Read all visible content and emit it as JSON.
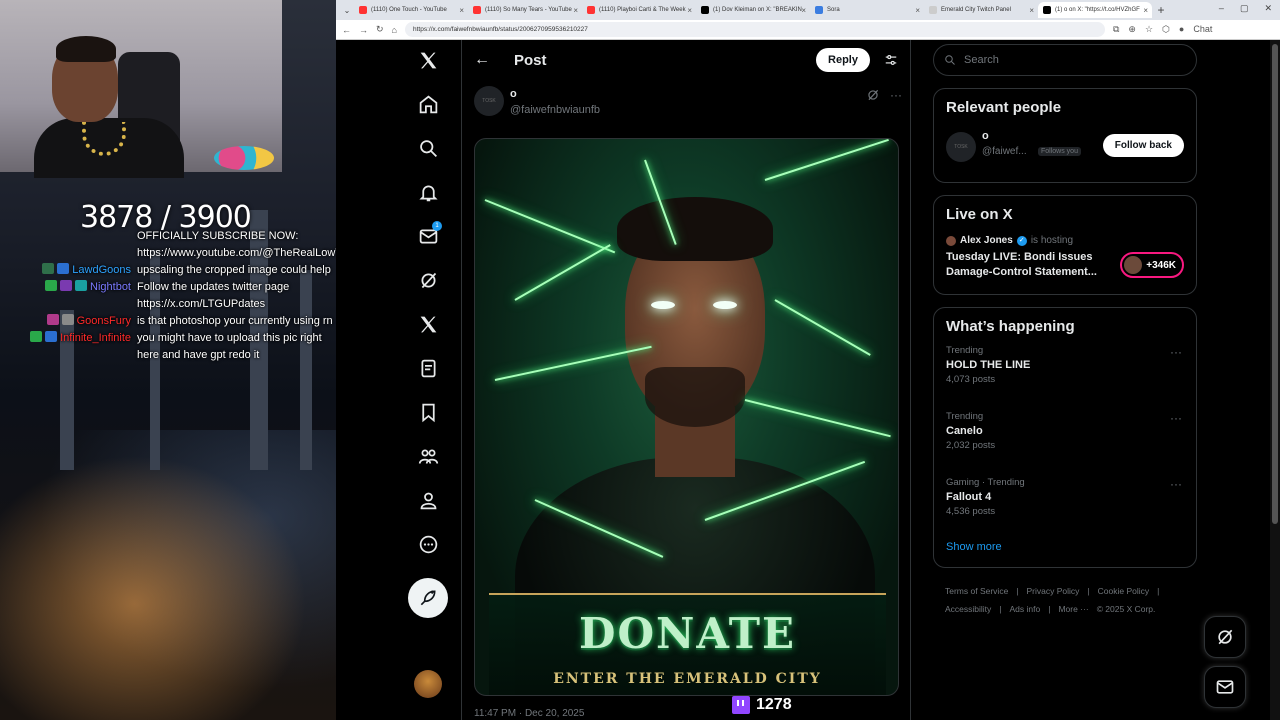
{
  "stream": {
    "sub_count": "3878 / 3900",
    "chat": [
      {
        "user": "",
        "user_color": "#ffffff",
        "message": "OFFICIALLY SUBSCRIBE NOW:"
      },
      {
        "user": "",
        "user_color": "#ffffff",
        "message": "https://www.youtube.com/@TheRealLowTierGod"
      },
      {
        "user": "LawdGoons",
        "user_color": "#2ea3ff",
        "message": "upscaling the cropped image could help"
      },
      {
        "user": "Nightbot",
        "user_color": "#7a7aff",
        "message": "Follow the updates twitter page https://x.com/LTGUPdates"
      },
      {
        "user": "GoonsFury",
        "user_color": "#ff2a2a",
        "message": "is that photoshop your currently using rn"
      },
      {
        "user": "Infinite_Infinite",
        "user_color": "#ff2a2a",
        "message": "you might have to upload this pic right here and have gpt redo it"
      }
    ]
  },
  "browser": {
    "tabs": [
      {
        "title": "(1110) One Touch - YouTube",
        "icon": "youtube-icon",
        "active": false
      },
      {
        "title": "(1110) So Many Tears - YouTube",
        "icon": "youtube-icon",
        "active": false
      },
      {
        "title": "(1110) Playboi Carti & The Week",
        "icon": "youtube-icon",
        "active": false
      },
      {
        "title": "(1) Dov Kleiman on X: \"BREAKIN",
        "icon": "x-icon",
        "active": false
      },
      {
        "title": "Sora",
        "icon": "sora-icon",
        "active": false
      },
      {
        "title": "Emerald City Twitch Panel",
        "icon": "page-icon",
        "active": false
      },
      {
        "title": "(1) o on X: \"https://t.co/HVZhGF",
        "icon": "x-icon",
        "active": true
      }
    ],
    "url": "https://x.com/faiwefnbwiaunfb/status/2006270959536210227",
    "chat_label": "Chat"
  },
  "x": {
    "header_title": "Post",
    "reply_label": "Reply",
    "messages_badge": "1",
    "author": {
      "name": "o",
      "handle": "@faiwefnbwiaunfb",
      "avatar_text": "TOSK"
    },
    "image": {
      "headline": "DONATE",
      "tagline": "ENTER THE EMERALD CITY"
    },
    "timestamp": "11:47 PM · Dec 20, 2025",
    "twitch_count": "1278",
    "search_placeholder": "Search",
    "relevant_people": {
      "title": "Relevant people",
      "name": "o",
      "handle": "@faiwef...",
      "follows_you": "Follows you",
      "button": "Follow back",
      "avatar_text": "TOSK"
    },
    "live": {
      "title": "Live on X",
      "host": "Alex Jones",
      "hosting": "is hosting",
      "space_title": "Tuesday LIVE: Bondi Issues Damage-Control Statement...",
      "listeners": "+346K"
    },
    "happening": {
      "title": "What’s happening",
      "trends": [
        {
          "meta": "Trending",
          "name": "HOLD THE LINE",
          "posts": "4,073 posts"
        },
        {
          "meta": "Trending",
          "name": "Canelo",
          "posts": "2,032 posts"
        },
        {
          "meta": "Gaming · Trending",
          "name": "Fallout 4",
          "posts": "4,536 posts"
        }
      ],
      "show_more": "Show more"
    },
    "footer": [
      "Terms of Service",
      "|",
      "Privacy Policy",
      "|",
      "Cookie Policy",
      "|",
      "Accessibility",
      "|",
      "Ads info",
      "|",
      "More ···",
      "© 2025 X Corp."
    ]
  },
  "colors": {
    "accent": "#1d9bf0",
    "live_ring": "#f91880",
    "twitch": "#9146ff"
  }
}
